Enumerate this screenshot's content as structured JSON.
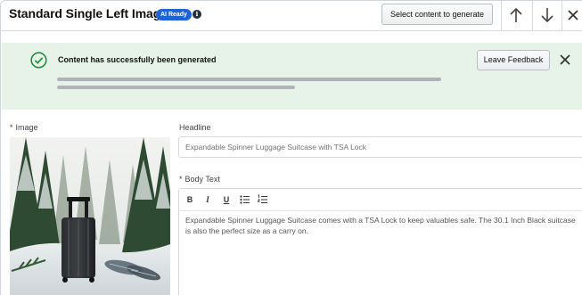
{
  "header": {
    "title": "Standard Single Left Image",
    "badge": "AI Ready",
    "info_glyph": "i",
    "generate_button": "Select content to generate",
    "icons": [
      "arrow-up-icon",
      "arrow-down-icon",
      "close-icon"
    ]
  },
  "banner": {
    "message": "Content has successfully been generated",
    "feedback_button": "Leave Feedback",
    "icons": [
      "check-circle-icon",
      "close-icon"
    ],
    "colors": {
      "background": "#e7f3e9",
      "check": "#1f8f3a"
    }
  },
  "form": {
    "image_label": "Image",
    "headline_label": "Headline",
    "headline_value": "Expandable Spinner Luggage Suitcase with TSA Lock",
    "body_label": "Body Text",
    "required_mark": "*",
    "toolbar": {
      "bold": "B",
      "italic": "I",
      "underline": "U",
      "icons": [
        "bullet-list-icon",
        "numbered-list-icon"
      ]
    },
    "body_value": "Expandable Spinner Luggage Suitcase comes with a TSA Lock to keep valuables safe. The 30.1 Inch Black suitcase is also the perfect size as a carry on."
  },
  "colors": {
    "accent": "#1d62d6",
    "border": "#d5d9d9"
  }
}
